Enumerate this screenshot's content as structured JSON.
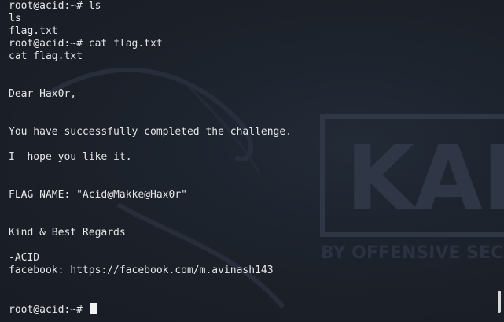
{
  "terminal": {
    "lines": [
      "root@acid:~# ls",
      "ls",
      "flag.txt",
      "root@acid:~# cat flag.txt",
      "cat flag.txt",
      "",
      "",
      "Dear Hax0r,",
      "",
      "",
      "You have successfully completed the challenge.",
      "",
      "I  hope you like it.",
      "",
      "",
      "FLAG NAME: \"Acid@Makke@Hax0r\"",
      "",
      "",
      "Kind & Best Regards",
      "",
      "-ACID",
      "facebook: https://facebook.com/m.avinash143",
      "",
      "",
      "root@acid:~# "
    ]
  },
  "watermark": {
    "logo_text": "KAL",
    "tagline": "BY OFFENSIVE SEC"
  }
}
